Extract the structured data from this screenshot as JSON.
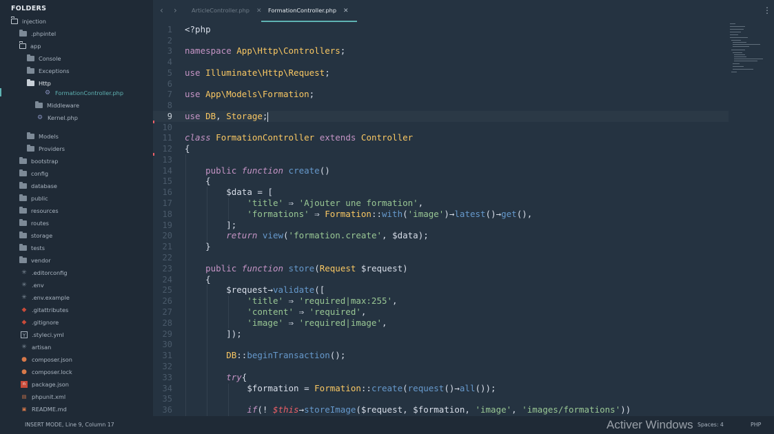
{
  "sidebar": {
    "title": "FOLDERS",
    "items": [
      {
        "label": "injection",
        "icon": "folder-open-icon"
      },
      {
        "label": ".phpintel",
        "icon": "folder-icon"
      },
      {
        "label": "app",
        "icon": "folder-open-icon"
      },
      {
        "label": "Console",
        "icon": "folder-icon"
      },
      {
        "label": "Exceptions",
        "icon": "folder-icon"
      },
      {
        "label": "Http",
        "icon": "folder-icon"
      },
      {
        "label": "FormationController.php",
        "icon": "php-file-icon"
      },
      {
        "label": "Middleware",
        "icon": "folder-icon"
      },
      {
        "label": "Kernel.php",
        "icon": "php-file-icon"
      },
      {
        "label": "Models",
        "icon": "folder-icon"
      },
      {
        "label": "Providers",
        "icon": "folder-icon"
      },
      {
        "label": "bootstrap",
        "icon": "folder-icon"
      },
      {
        "label": "config",
        "icon": "folder-icon"
      },
      {
        "label": "database",
        "icon": "folder-icon"
      },
      {
        "label": "public",
        "icon": "folder-icon"
      },
      {
        "label": "resources",
        "icon": "folder-icon"
      },
      {
        "label": "routes",
        "icon": "folder-icon"
      },
      {
        "label": "storage",
        "icon": "folder-icon"
      },
      {
        "label": "tests",
        "icon": "folder-icon"
      },
      {
        "label": "vendor",
        "icon": "folder-icon"
      },
      {
        "label": ".editorconfig",
        "icon": "asterisk-icon"
      },
      {
        "label": ".env",
        "icon": "asterisk-icon"
      },
      {
        "label": ".env.example",
        "icon": "asterisk-icon"
      },
      {
        "label": ".gitattributes",
        "icon": "git-icon"
      },
      {
        "label": ".gitignore",
        "icon": "git-icon"
      },
      {
        "label": ".styleci.yml",
        "icon": "yaml-icon"
      },
      {
        "label": "artisan",
        "icon": "asterisk-icon"
      },
      {
        "label": "composer.json",
        "icon": "composer-icon"
      },
      {
        "label": "composer.lock",
        "icon": "composer-icon"
      },
      {
        "label": "package.json",
        "icon": "npm-icon"
      },
      {
        "label": "phpunit.xml",
        "icon": "xml-icon"
      },
      {
        "label": "README.md",
        "icon": "markdown-icon"
      }
    ]
  },
  "tabs": [
    {
      "label": "ArticleController.php",
      "close": "✕"
    },
    {
      "label": "FormationController.php",
      "close": "✕"
    }
  ],
  "nav": {
    "back": "‹",
    "forward": "›",
    "menu": "⋮"
  },
  "editor": {
    "line_numbers": [
      "1",
      "2",
      "3",
      "4",
      "5",
      "6",
      "7",
      "8",
      "9",
      "10",
      "11",
      "12",
      "13",
      "14",
      "15",
      "16",
      "17",
      "18",
      "19",
      "20",
      "21",
      "22",
      "23",
      "24",
      "25",
      "26",
      "27",
      "28",
      "29",
      "30",
      "31",
      "32",
      "33",
      "34",
      "35",
      "36"
    ],
    "current_line": "9",
    "tokens": {
      "l1_open": "<?php",
      "l3_ns": "namespace",
      "l3_path": "App\\Http\\Controllers",
      "l3_semi": ";",
      "l5_use": "use",
      "l5_path": "Illuminate\\Http\\Request",
      "l5_semi": ";",
      "l7_use": "use",
      "l7_path": "App\\Models\\Formation",
      "l7_semi": ";",
      "l9_use": "use",
      "l9_a": "DB",
      "l9_comma": ", ",
      "l9_b": "Storage",
      "l9_semi": ";",
      "l11_class": "class",
      "l11_name": "FormationController",
      "l11_extends": "extends",
      "l11_parent": "Controller",
      "l12_brace": "{",
      "l14_public": "public",
      "l14_function": "function",
      "l14_name": "create",
      "l14_parens": "()",
      "l15_brace": "{",
      "l16_var": "$data",
      "l16_rest": " = [",
      "l17_key": "'title'",
      "l17_arrow": " ⇒ ",
      "l17_val": "'Ajouter une formation'",
      "l17_comma": ",",
      "l18_key": "'formations'",
      "l18_arrow": " ⇒ ",
      "l18_cls": "Formation",
      "l18_sep": "::",
      "l18_with": "with",
      "l18_p1": "(",
      "l18_img": "'image'",
      "l18_p2": ")→",
      "l18_latest": "latest",
      "l18_p3": "()→",
      "l18_get": "get",
      "l18_p4": "(),",
      "l19_close": "];",
      "l20_return": "return",
      "l20_view": "view",
      "l20_p1": "(",
      "l20_str": "'formation.create'",
      "l20_p2": ", $data);",
      "l21_brace": "}",
      "l23_public": "public",
      "l23_function": "function",
      "l23_name": "store",
      "l23_p1": "(",
      "l23_type": "Request",
      "l23_var": " $request",
      "l23_p2": ")",
      "l24_brace": "{",
      "l25_var": "$request",
      "l25_arrow": "→",
      "l25_fn": "validate",
      "l25_rest": "([",
      "l26_key": "'title'",
      "l26_arrow": " ⇒ ",
      "l26_val": "'required|max:255'",
      "l26_comma": ",",
      "l27_key": "'content'",
      "l27_arrow": " ⇒ ",
      "l27_val": "'required'",
      "l27_comma": ",",
      "l28_key": "'image'",
      "l28_arrow": " ⇒ ",
      "l28_val": "'required|image'",
      "l28_comma": ",",
      "l29_close": "]);",
      "l31_cls": "DB",
      "l31_sep": "::",
      "l31_fn": "beginTransaction",
      "l31_rest": "();",
      "l33_try": "try",
      "l33_brace": "{",
      "l34_var": "$formation",
      "l34_eq": " = ",
      "l34_cls": "Formation",
      "l34_sep": "::",
      "l34_create": "create",
      "l34_p1": "(",
      "l34_request": "request",
      "l34_p2": "()→",
      "l34_all": "all",
      "l34_p3": "());",
      "l36_if": "if",
      "l36_p1": "(! ",
      "l36_this": "$this",
      "l36_arrow": "→",
      "l36_fn": "storeImage",
      "l36_p2": "($request, $formation, ",
      "l36_s1": "'image'",
      "l36_c": ", ",
      "l36_s2": "'images/formations'",
      "l36_p3": "))"
    }
  },
  "statusbar": {
    "mode": "INSERT MODE, Line 9, Column 17",
    "spaces": "Spaces: 4",
    "language": "PHP"
  },
  "watermark": "Activer Windows",
  "colors": {
    "background": "#253341",
    "sidebar": "#1f2a36",
    "keyword": "#c594c5",
    "type": "#fac863",
    "function": "#6699cc",
    "string": "#99c794",
    "accent": "#5fb3b3"
  }
}
